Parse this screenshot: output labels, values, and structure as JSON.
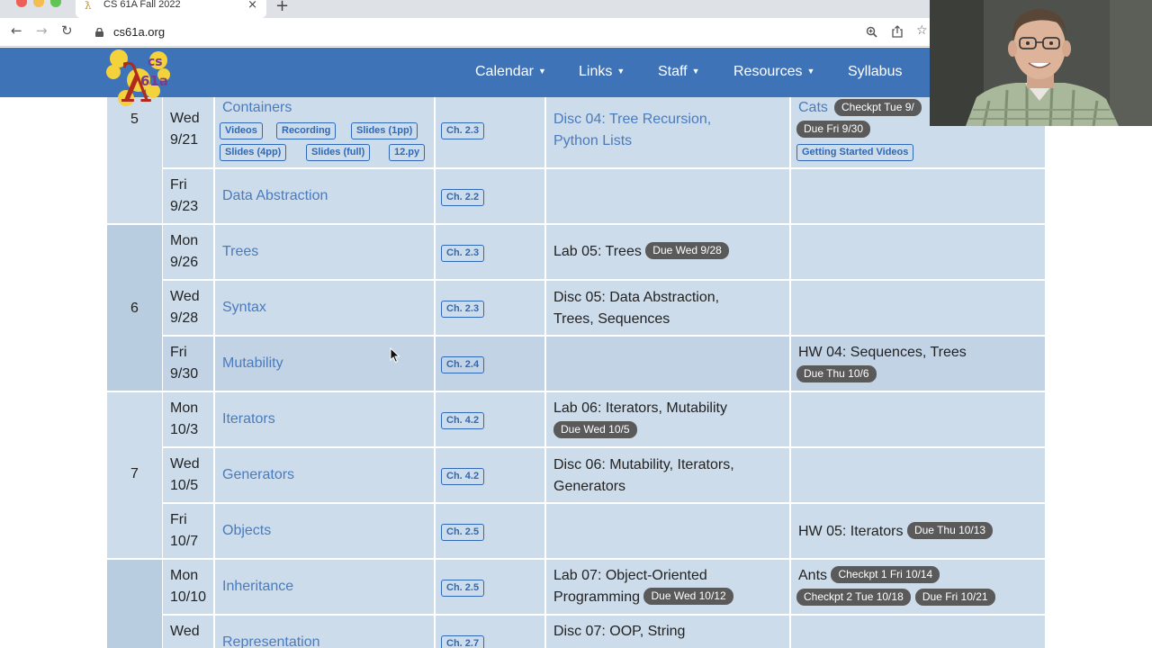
{
  "browser": {
    "tab_title": "CS 61A Fall 2022",
    "tab_favicon": "ƛ",
    "url": "cs61a.org",
    "colors": {
      "close": "#ee5f57",
      "minimize": "#f4bd4f",
      "maximize": "#61c554"
    }
  },
  "site": {
    "logo_text_top": "cs",
    "logo_text_bottom": "61a",
    "logo_lambda": "λ",
    "nav": [
      {
        "label": "Calendar",
        "dropdown": true
      },
      {
        "label": "Links",
        "dropdown": true
      },
      {
        "label": "Staff",
        "dropdown": true
      },
      {
        "label": "Resources",
        "dropdown": true
      },
      {
        "label": "Syllabus",
        "dropdown": false
      }
    ],
    "accent_color": "#3f73b8"
  },
  "schedule": {
    "weeks": [
      {
        "number": "5"
      },
      {
        "number": "6"
      },
      {
        "number": "7"
      },
      {
        "number": ""
      }
    ],
    "rows": [
      {
        "day": "Wed",
        "date": "9/21",
        "lecture": "Containers",
        "materials": [
          "Videos",
          "Recording",
          "Slides (1pp)",
          "Slides (4pp)",
          "Slides (full)",
          "12.py"
        ],
        "reading": "Ch. 2.3",
        "lab": "Disc 04: Tree Recursion,",
        "lab_line2": "Python Lists",
        "hw": "Cats",
        "hw_badges": [
          "Checkpt Tue 9/",
          "Due Fri 9/30"
        ],
        "hw_extra": "Getting Started Videos"
      },
      {
        "day": "Fri",
        "date": "9/23",
        "lecture": "Data Abstraction",
        "reading": "Ch. 2.2"
      },
      {
        "day": "Mon",
        "date": "9/26",
        "lecture": "Trees",
        "reading": "Ch. 2.3",
        "lab": "Lab 05: Trees",
        "lab_due": "Due Wed 9/28"
      },
      {
        "day": "Wed",
        "date": "9/28",
        "lecture": "Syntax",
        "reading": "Ch. 2.3",
        "lab": "Disc 05: Data Abstraction,",
        "lab_line2": "Trees, Sequences"
      },
      {
        "day": "Fri",
        "date": "9/30",
        "lecture": "Mutability",
        "reading": "Ch. 2.4",
        "hw": "HW 04: Sequences, Trees",
        "hw_due": "Due Thu 10/6"
      },
      {
        "day": "Mon",
        "date": "10/3",
        "lecture": "Iterators",
        "reading": "Ch. 4.2",
        "lab": "Lab 06: Iterators, Mutability",
        "lab_due": "Due Wed 10/5"
      },
      {
        "day": "Wed",
        "date": "10/5",
        "lecture": "Generators",
        "reading": "Ch. 4.2",
        "lab": "Disc 06: Mutability, Iterators,",
        "lab_line2": "Generators"
      },
      {
        "day": "Fri",
        "date": "10/7",
        "lecture": "Objects",
        "reading": "Ch. 2.5",
        "hw": "HW 05: Iterators",
        "hw_due": "Due Thu 10/13"
      },
      {
        "day": "Mon",
        "date": "10/10",
        "lecture": "Inheritance",
        "reading": "Ch. 2.5",
        "lab": "Lab 07: Object-Oriented",
        "lab_line2": "Programming",
        "lab_due": "Due Wed 10/12",
        "hw": "Ants",
        "hw_badges": [
          "Checkpt 1 Fri 10/14",
          "Checkpt 2 Tue 10/18",
          "Due Fri 10/21"
        ]
      },
      {
        "day": "Wed",
        "date": "",
        "lecture": "Representation",
        "reading": "Ch. 2.7",
        "lab": "Disc 07: OOP, String"
      }
    ]
  }
}
